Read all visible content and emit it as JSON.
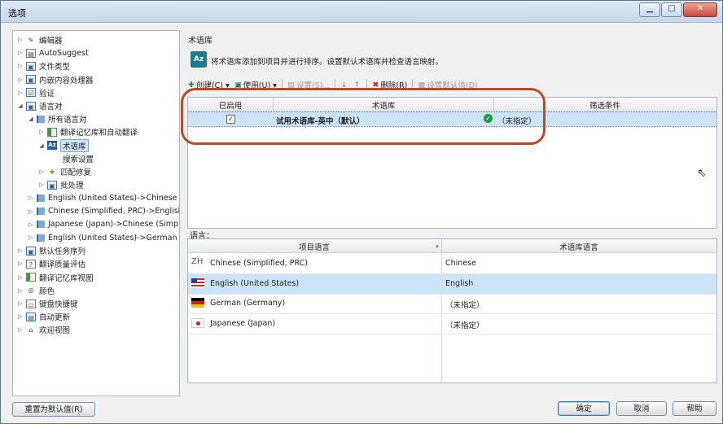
{
  "window": {
    "title": "选项"
  },
  "tree": [
    {
      "label": "编辑器",
      "icon": "pen-icon",
      "twisty": "▷",
      "indent": 0
    },
    {
      "label": "AutoSuggest",
      "icon": "autosuggest-icon",
      "twisty": "▷",
      "indent": 0
    },
    {
      "label": "文件类型",
      "icon": "file-type-icon",
      "twisty": "▷",
      "indent": 0
    },
    {
      "label": "内嵌内容处理器",
      "icon": "embedded-content-icon",
      "twisty": "▷",
      "indent": 0
    },
    {
      "label": "验证",
      "icon": "verification-icon",
      "twisty": "▷",
      "indent": 0
    },
    {
      "label": "语言对",
      "icon": "language-pairs-icon",
      "twisty": "◢",
      "indent": 0
    },
    {
      "label": "所有语言对",
      "icon": "flag-icon",
      "twisty": "◢",
      "indent": 1
    },
    {
      "label": "翻译记忆库和自动翻译",
      "icon": "tm-icon",
      "twisty": "▷",
      "indent": 2
    },
    {
      "label": "术语库",
      "icon": "termbase-icon",
      "twisty": "◢",
      "indent": 2,
      "selected": true
    },
    {
      "label": "搜索设置",
      "icon": "",
      "twisty": "",
      "indent": 3
    },
    {
      "label": "匹配修复",
      "icon": "wrench-icon",
      "twisty": "▷",
      "indent": 2
    },
    {
      "label": "批处理",
      "icon": "batch-icon",
      "twisty": "▷",
      "indent": 2
    },
    {
      "label": "English (United States)->Chinese (",
      "icon": "flag-icon",
      "twisty": "▷",
      "indent": 1
    },
    {
      "label": "Chinese (Simplified, PRC)->English",
      "icon": "flag-icon",
      "twisty": "▷",
      "indent": 1
    },
    {
      "label": "Japanese (Japan)->Chinese (Simpli",
      "icon": "flag-icon",
      "twisty": "▷",
      "indent": 1
    },
    {
      "label": "English (United States)->German (",
      "icon": "flag-icon",
      "twisty": "▷",
      "indent": 1
    },
    {
      "label": "默认任务序列",
      "icon": "task-sequence-icon",
      "twisty": "▷",
      "indent": 0
    },
    {
      "label": "翻译质量评估",
      "icon": "quality-icon",
      "twisty": "▷",
      "indent": 0
    },
    {
      "label": "翻译记忆库视图",
      "icon": "tm-view-icon",
      "twisty": "▷",
      "indent": 0
    },
    {
      "label": "颜色",
      "icon": "color-icon",
      "twisty": "▷",
      "indent": 0
    },
    {
      "label": "键盘快捷键",
      "icon": "keyboard-icon",
      "twisty": "▷",
      "indent": 0
    },
    {
      "label": "自动更新",
      "icon": "update-icon",
      "twisty": "▷",
      "indent": 0
    },
    {
      "label": "欢迎视图",
      "icon": "home-icon",
      "twisty": "▷",
      "indent": 0
    }
  ],
  "termbase": {
    "section_title": "术语库",
    "description": "将术语库添加到项目并进行排序。设置默认术语库并检查语言映射。",
    "toolbar": {
      "create": "创建(C) ▾",
      "use": "使用(U) ▾",
      "settings": "设置(S)...",
      "delete": "删除(R)",
      "set_default": "设置默认值(D)"
    },
    "columns": [
      "已启用",
      "术语库",
      "筛选条件"
    ],
    "rows": [
      {
        "enabled": "✓",
        "name": "试用术语库-英中（默认）",
        "status": "（未指定）"
      }
    ]
  },
  "languages": {
    "section_title": "语言：",
    "columns": [
      "项目语言",
      "术语库语言"
    ],
    "sort_arrow": "▴",
    "rows": [
      {
        "flag": "zh",
        "flag_text": "ZH",
        "project": "Chinese (Simplified, PRC)",
        "termbase": "Chinese"
      },
      {
        "flag": "us",
        "flag_text": "",
        "project": "English (United States)",
        "termbase": "English",
        "selected": true
      },
      {
        "flag": "de",
        "flag_text": "",
        "project": "German (Germany)",
        "termbase": "（未指定）"
      },
      {
        "flag": "jp",
        "flag_text": "",
        "project": "Japanese (Japan)",
        "termbase": "（未指定）"
      }
    ]
  },
  "buttons": {
    "reset": "重置为默认值(R)",
    "ok": "确定",
    "cancel": "取消",
    "help": "帮助"
  }
}
